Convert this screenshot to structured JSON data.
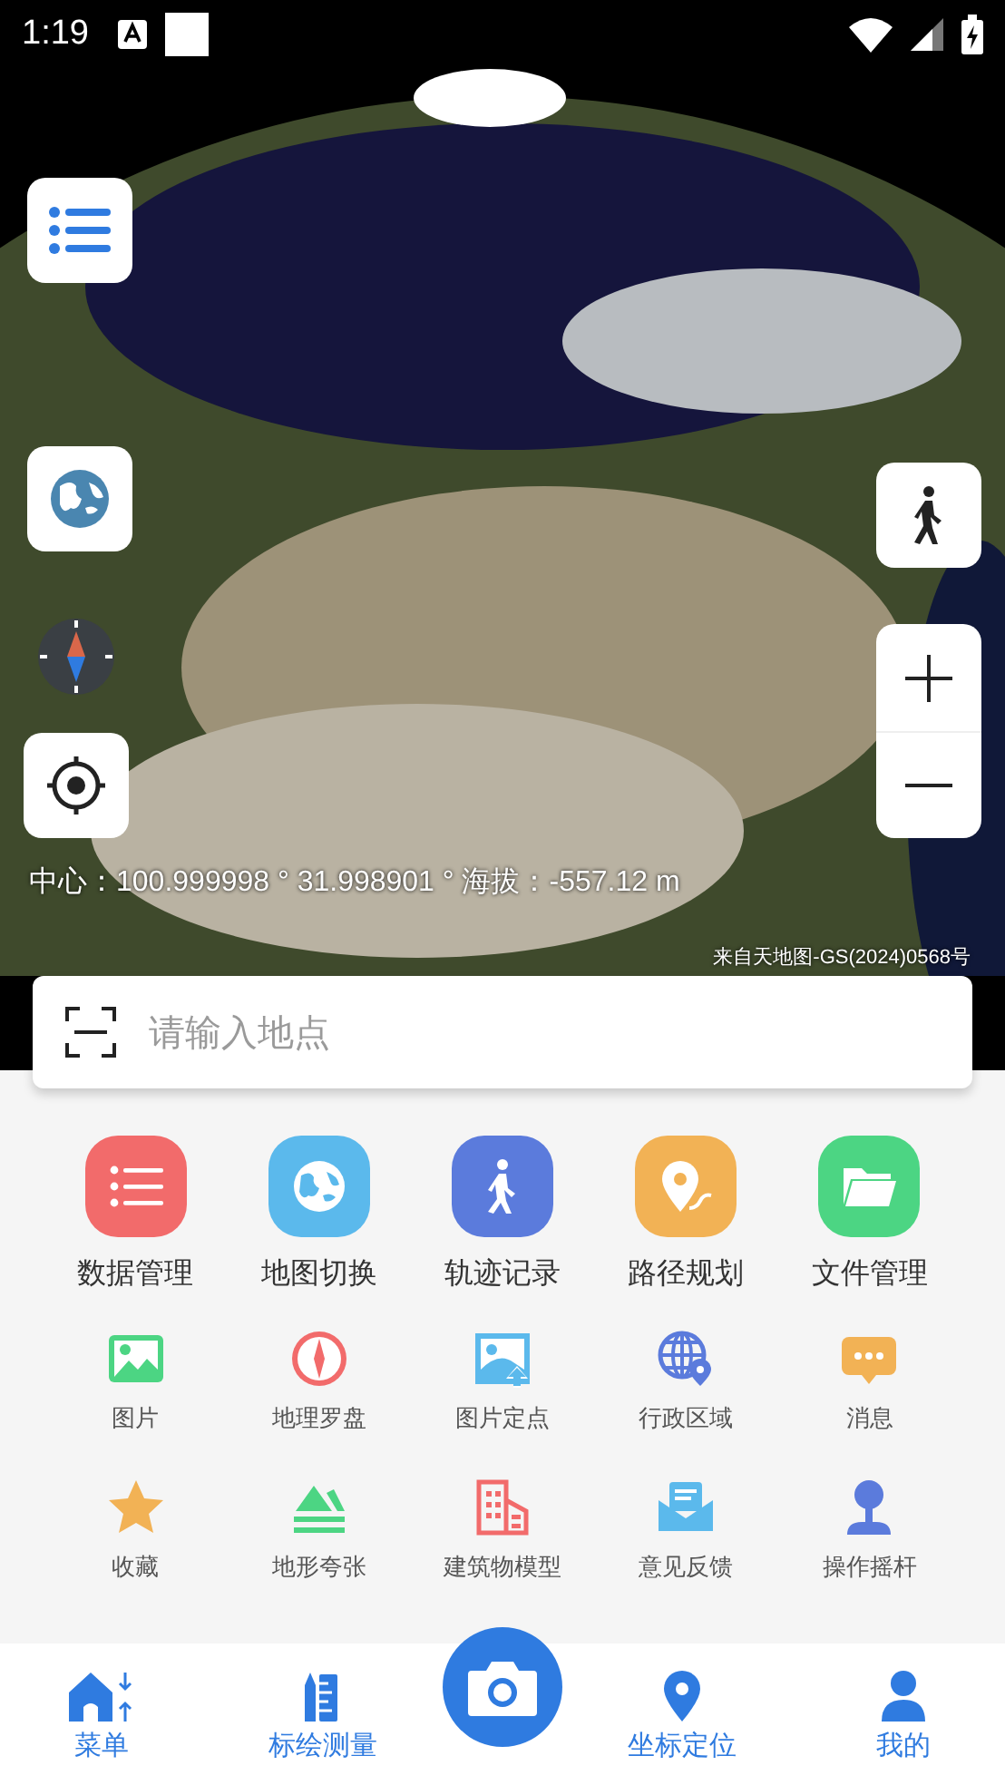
{
  "status_bar": {
    "time": "1:19"
  },
  "map": {
    "center_readout": "中心：100.999998 ° 31.998901 ° 海拔：-557.12 m",
    "attribution": "来自天地图-GS(2024)0568号"
  },
  "search": {
    "placeholder": "请输入地点"
  },
  "main_tools": [
    {
      "label": "数据管理",
      "kind": "list",
      "color": "#f26b6b"
    },
    {
      "label": "地图切换",
      "kind": "globe",
      "color": "#5bb9ec"
    },
    {
      "label": "轨迹记录",
      "kind": "walk",
      "color": "#5b7bdc"
    },
    {
      "label": "路径规划",
      "kind": "route",
      "color": "#f2b255"
    },
    {
      "label": "文件管理",
      "kind": "folder",
      "color": "#4cd583"
    }
  ],
  "small_tools": [
    {
      "label": "图片",
      "kind": "image",
      "color": "#4cd583"
    },
    {
      "label": "地理罗盘",
      "kind": "compass",
      "color": "#f26b6b"
    },
    {
      "label": "图片定点",
      "kind": "image-pin",
      "color": "#5bb9ec"
    },
    {
      "label": "行政区域",
      "kind": "globe-pin",
      "color": "#5b7bdc"
    },
    {
      "label": "消息",
      "kind": "chat",
      "color": "#f2b255"
    },
    {
      "label": "收藏",
      "kind": "star",
      "color": "#f2b255"
    },
    {
      "label": "地形夸张",
      "kind": "terrain",
      "color": "#4cd583"
    },
    {
      "label": "建筑物模型",
      "kind": "building",
      "color": "#f26b6b"
    },
    {
      "label": "意见反馈",
      "kind": "mail",
      "color": "#5bb9ec"
    },
    {
      "label": "操作摇杆",
      "kind": "joystick",
      "color": "#5b7bdc"
    }
  ],
  "bottom_nav": [
    {
      "label": "菜单",
      "kind": "home"
    },
    {
      "label": "标绘测量",
      "kind": "ruler"
    },
    {
      "label": "坐标定位",
      "kind": "pin"
    },
    {
      "label": "我的",
      "kind": "person"
    }
  ]
}
